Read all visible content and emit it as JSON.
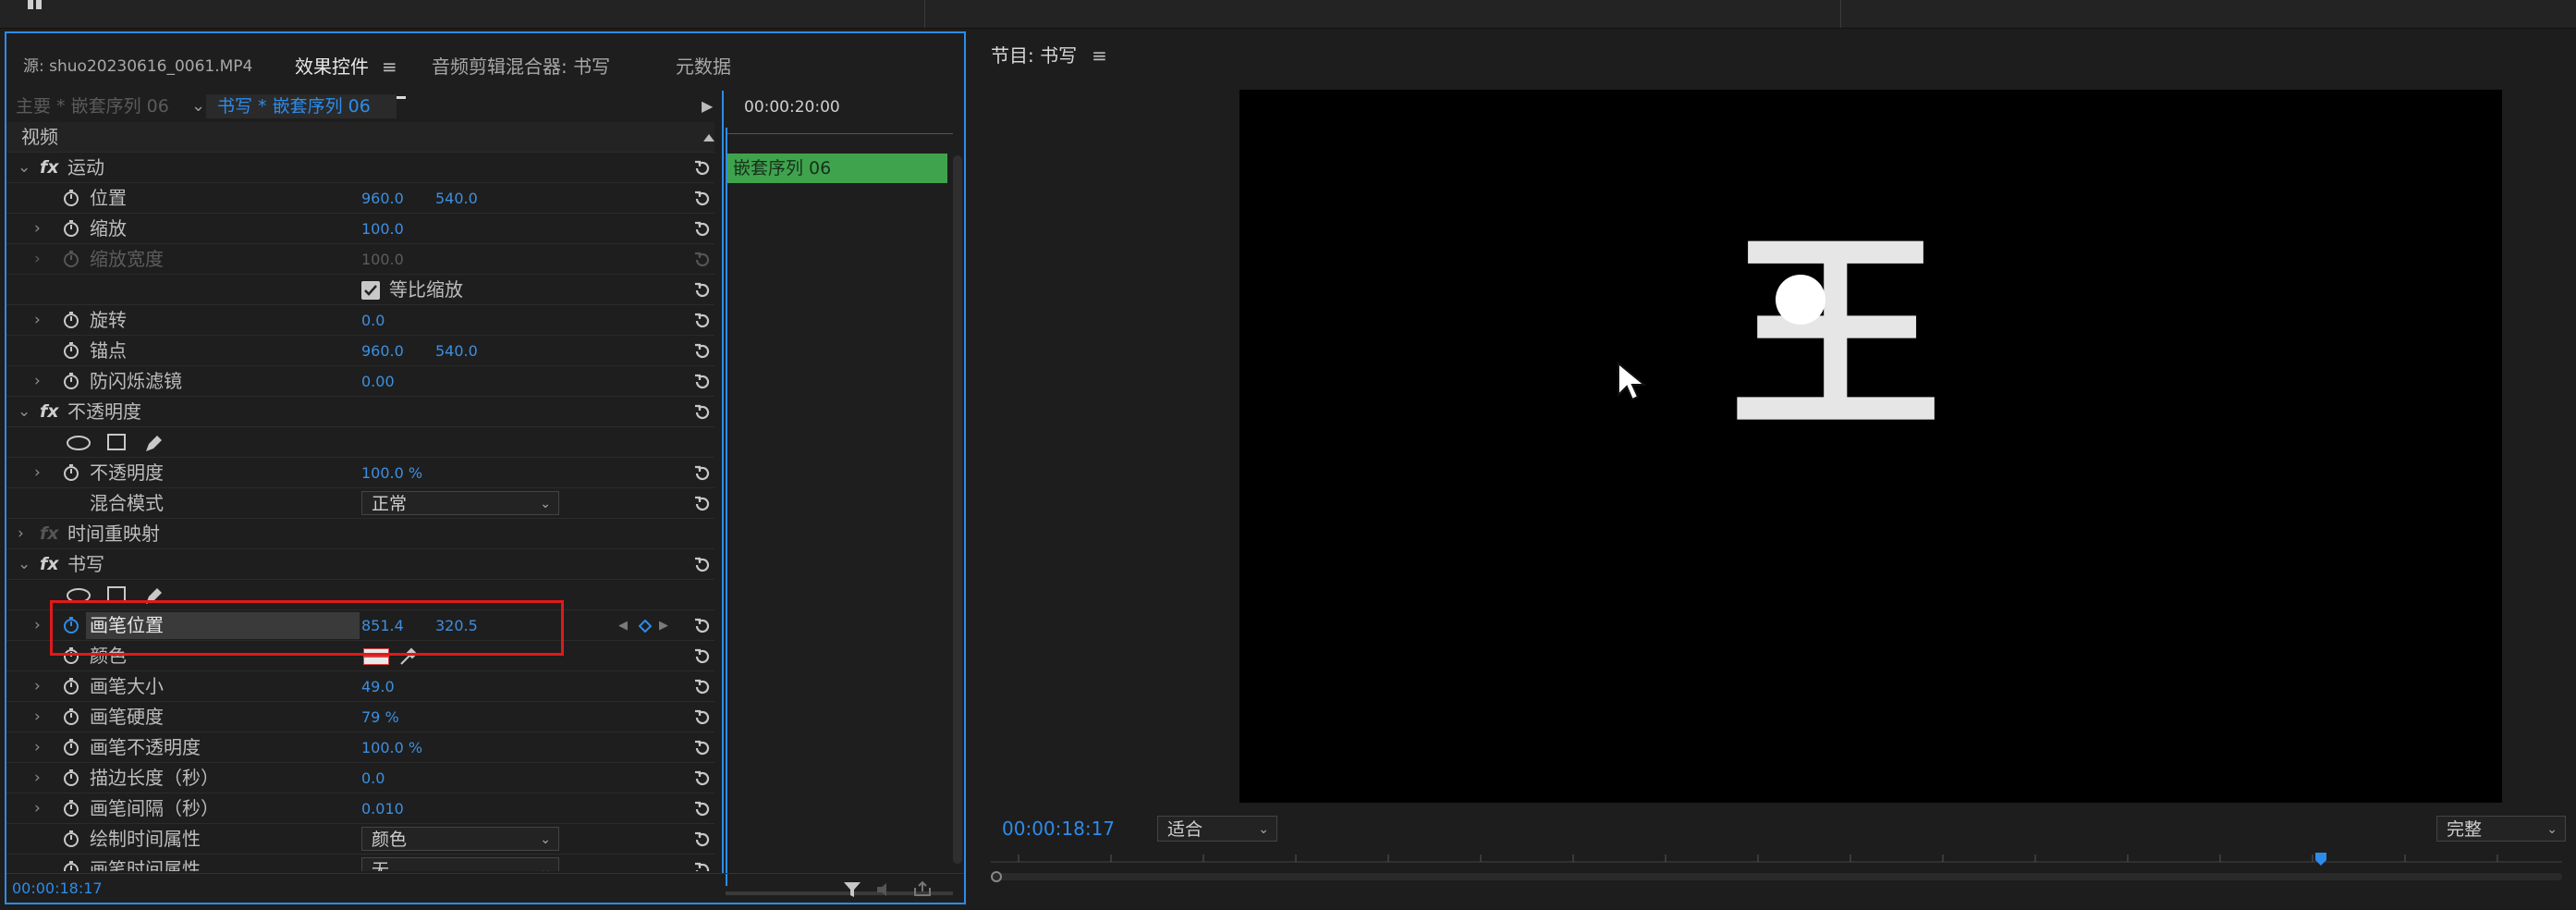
{
  "source_tab": {
    "label": "源: shuo20230616_0061.MP4"
  },
  "tabs": [
    {
      "label": "效果控件",
      "active": true,
      "menu": "≡"
    },
    {
      "label": "音频剪辑混合器: 书写",
      "active": false
    },
    {
      "label": "元数据",
      "active": false
    }
  ],
  "breadcrumb": {
    "master": "主要 * 嵌套序列 06",
    "clip": "书写 * 嵌套序列 06"
  },
  "mini_timeline": {
    "timecode": "00:00:20:00",
    "clip_label": "嵌套序列 06"
  },
  "rows": {
    "video_header": "视频",
    "motion": {
      "label": "运动"
    },
    "position": {
      "label": "位置",
      "x": "960.0",
      "y": "540.0"
    },
    "scale": {
      "label": "缩放",
      "value": "100.0"
    },
    "scale_width": {
      "label": "缩放宽度",
      "value": "100.0"
    },
    "uniform_scale": {
      "label": "等比缩放",
      "checked": true
    },
    "rotation": {
      "label": "旋转",
      "value": "0.0"
    },
    "anchor": {
      "label": "锚点",
      "x": "960.0",
      "y": "540.0"
    },
    "anti_flicker": {
      "label": "防闪烁滤镜",
      "value": "0.00"
    },
    "opacity_group": {
      "label": "不透明度"
    },
    "opacity": {
      "label": "不透明度",
      "value": "100.0 %"
    },
    "blend_mode": {
      "label": "混合模式",
      "value": "正常"
    },
    "time_remap": {
      "label": "时间重映射"
    },
    "write_group": {
      "label": "书写"
    },
    "brush_position": {
      "label": "画笔位置",
      "x": "851.4",
      "y": "320.5"
    },
    "color": {
      "label": "颜色"
    },
    "brush_size": {
      "label": "画笔大小",
      "value": "49.0"
    },
    "brush_hardness": {
      "label": "画笔硬度",
      "value": "79 %"
    },
    "brush_opacity": {
      "label": "画笔不透明度",
      "value": "100.0 %"
    },
    "stroke_length": {
      "label": "描边长度（秒）",
      "value": "0.0"
    },
    "brush_spacing": {
      "label": "画笔间隔（秒）",
      "value": "0.010"
    },
    "paint_time_props": {
      "label": "绘制时间属性",
      "value": "颜色"
    },
    "brush_time_props": {
      "label": "画笔时间属性",
      "value": "无"
    }
  },
  "footer": {
    "timecode": "00:00:18:17"
  },
  "program": {
    "title": "节目: 书写",
    "menu": "≡",
    "timecode": "00:00:18:17",
    "fit": "适合",
    "quality": "完整",
    "character": "王"
  },
  "colors": {
    "accent": "#2d8ceb",
    "clip_green": "#3fa34d",
    "highlight_red": "#e01919"
  },
  "icons": [
    "stopwatch-icon",
    "reset-icon",
    "fx-icon",
    "ellipse-mask-icon",
    "rect-mask-icon",
    "pen-mask-icon",
    "eyedropper-icon",
    "filter-icon",
    "mouse-cursor-icon"
  ]
}
